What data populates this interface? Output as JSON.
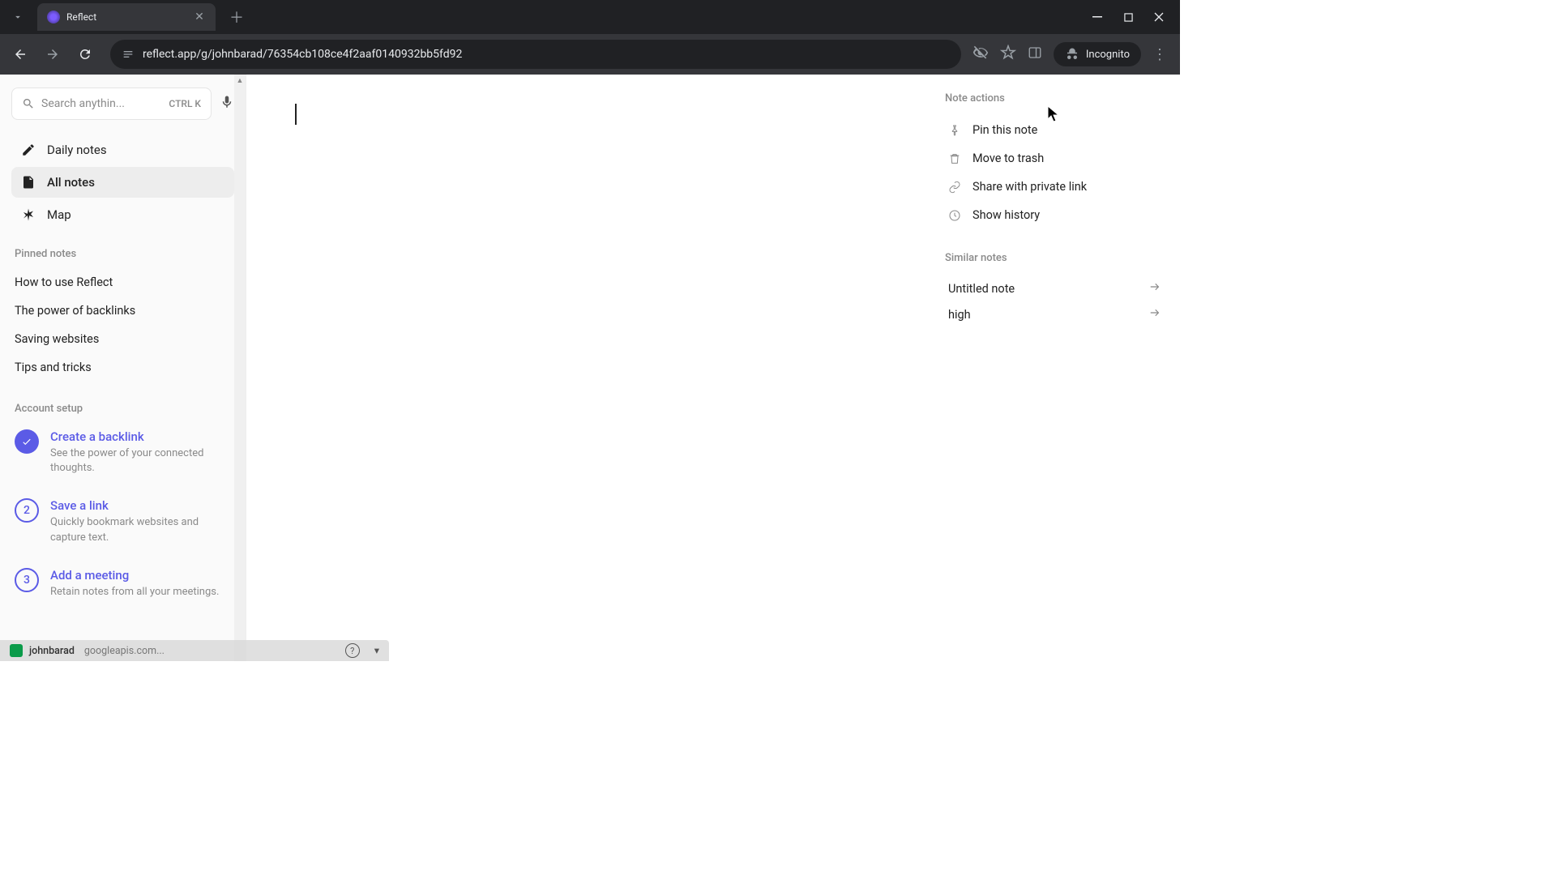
{
  "browser": {
    "tab_title": "Reflect",
    "url": "reflect.app/g/johnbarad/76354cb108ce4f2aaf0140932bb5fd92",
    "incognito_label": "Incognito"
  },
  "sidebar": {
    "search": {
      "placeholder": "Search anythin...",
      "shortcut": "CTRL K"
    },
    "nav": [
      {
        "label": "Daily notes",
        "icon": "pencil"
      },
      {
        "label": "All notes",
        "icon": "document",
        "active": true
      },
      {
        "label": "Map",
        "icon": "asterisk"
      }
    ],
    "pinned_header": "Pinned notes",
    "pinned": [
      {
        "label": "How to use Reflect"
      },
      {
        "label": "The power of backlinks"
      },
      {
        "label": "Saving websites"
      },
      {
        "label": "Tips and tricks"
      }
    ],
    "setup_header": "Account setup",
    "setup": [
      {
        "badge": "done",
        "title": "Create a backlink",
        "desc": "See the power of your connected thoughts."
      },
      {
        "badge": "2",
        "title": "Save a link",
        "desc": "Quickly bookmark websites and capture text."
      },
      {
        "badge": "3",
        "title": "Add a meeting",
        "desc": "Retain notes from all your meetings."
      }
    ]
  },
  "status": {
    "user": "johnbarad",
    "loading": "googleapis.com..."
  },
  "right_panel": {
    "actions_header": "Note actions",
    "actions": [
      {
        "label": "Pin this note",
        "icon": "pin"
      },
      {
        "label": "Move to trash",
        "icon": "trash"
      },
      {
        "label": "Share with private link",
        "icon": "link"
      },
      {
        "label": "Show history",
        "icon": "clock"
      }
    ],
    "similar_header": "Similar notes",
    "similar": [
      {
        "label": "Untitled note"
      },
      {
        "label": "high"
      }
    ]
  }
}
